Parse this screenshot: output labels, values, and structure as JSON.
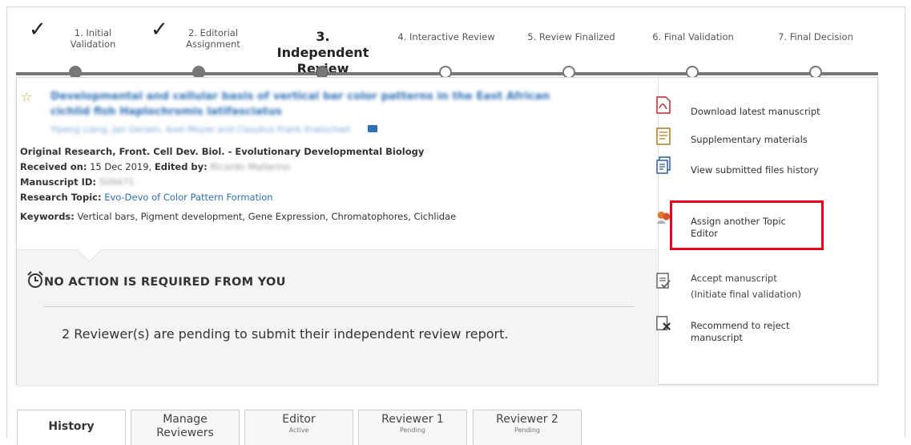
{
  "steps": [
    {
      "label_line1": "1. Initial",
      "label_line2": "Validation",
      "status": "done"
    },
    {
      "label_line1": "2. Editorial",
      "label_line2": "Assignment",
      "status": "done"
    },
    {
      "label_line1": "3. Independent",
      "label_line2": "Review",
      "status": "current"
    },
    {
      "label_line1": "4. Interactive Review",
      "label_line2": "",
      "status": "pending"
    },
    {
      "label_line1": "5. Review Finalized",
      "label_line2": "",
      "status": "pending"
    },
    {
      "label_line1": "6. Final Validation",
      "label_line2": "",
      "status": "pending"
    },
    {
      "label_line1": "7. Final Decision",
      "label_line2": "",
      "status": "pending"
    }
  ],
  "manuscript": {
    "title_line1": "Developmental and cellular basis of vertical bar color patterns in the East African",
    "title_line2": "cichlid fish Haplochromis latifasciatus",
    "authors": "Yipeng Liang, Jan Gerwin, Axel Meyer and Claudius Frank Kratochwil",
    "article_type": "Original Research, Front. Cell Dev. Biol. - Evolutionary Developmental Biology",
    "received_label": "Received on:",
    "received_value": "15 Dec 2019,",
    "edited_by_label": "Edited by:",
    "edited_by_value": "Ricardo Mallarino",
    "manuscript_id_label": "Manuscript ID:",
    "manuscript_id_value": "509471",
    "research_topic_label": "Research Topic:",
    "research_topic_value": "Evo-Devo of Color Pattern Formation",
    "keywords_label": "Keywords:",
    "keywords_value": "Vertical bars, Pigment development, Gene Expression, Chromatophores, Cichlidae"
  },
  "status_panel": {
    "heading": "NO ACTION IS REQUIRED FROM YOU",
    "message": "2 Reviewer(s) are pending to submit their independent review report."
  },
  "actions": {
    "download": "Download latest manuscript",
    "supplementary": "Supplementary materials",
    "history": "View submitted files history",
    "assign_line1": "Assign another Topic",
    "assign_line2": "Editor",
    "accept_line1": "Accept manuscript",
    "accept_line2": "(Initiate final validation)",
    "reject_line1": "Recommend to reject",
    "reject_line2": "manuscript"
  },
  "tabs": [
    {
      "label": "History",
      "sub": ""
    },
    {
      "label": "Manage",
      "label2": "Reviewers",
      "sub": ""
    },
    {
      "label": "Editor",
      "sub": "Active"
    },
    {
      "label": "Reviewer 1",
      "sub": "Pending"
    },
    {
      "label": "Reviewer 2",
      "sub": "Pending"
    }
  ],
  "colors": {
    "accent": "#2f6fb5",
    "highlight": "#e8001c",
    "pdf": "#c0282d"
  }
}
